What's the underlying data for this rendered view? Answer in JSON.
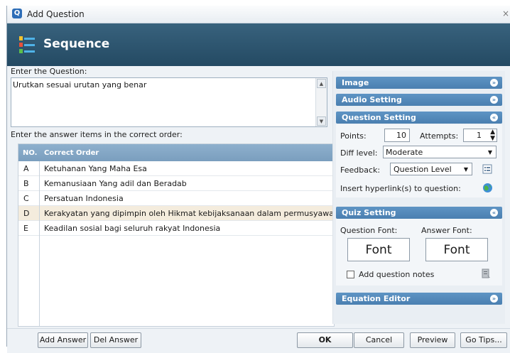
{
  "window": {
    "title": "Add Question",
    "close_glyph": "×"
  },
  "header": {
    "title": "Sequence",
    "icon": "numbered-list-icon"
  },
  "question": {
    "label": "Enter the Question:",
    "value": "Urutkan sesuai urutan yang benar"
  },
  "answers": {
    "label": "Enter the answer items in the correct order:",
    "columns": [
      "NO.",
      "Correct Order"
    ],
    "rows": [
      {
        "no": "A",
        "value": "Ketuhanan Yang Maha Esa"
      },
      {
        "no": "B",
        "value": "Kemanusiaan Yang adil dan Beradab"
      },
      {
        "no": "C",
        "value": "Persatuan Indonesia"
      },
      {
        "no": "D",
        "value": "Kerakyatan yang dipimpin oleh Hikmat kebijaksanaan dalam permusyawar..."
      },
      {
        "no": "E",
        "value": "Keadilan sosial bagi seluruh rakyat Indonesia"
      }
    ]
  },
  "right_panel": {
    "image": {
      "title": "Image"
    },
    "audio": {
      "title": "Audio Setting"
    },
    "question_setting": {
      "title": "Question Setting",
      "points_label": "Points:",
      "points_value": "10",
      "attempts_label": "Attempts:",
      "attempts_value": "1",
      "diff_label": "Diff level:",
      "diff_value": "Moderate",
      "feedback_label": "Feedback:",
      "feedback_value": "Question Level",
      "hyperlink_label": "Insert hyperlink(s) to question:"
    },
    "quiz_setting": {
      "title": "Quiz Setting",
      "question_font_label": "Question Font:",
      "answer_font_label": "Answer Font:",
      "question_font_button": "Font",
      "answer_font_button": "Font",
      "notes_label": "Add question notes"
    },
    "equation": {
      "title": "Equation Editor"
    }
  },
  "footer": {
    "add_answer": "Add Answer",
    "del_answer": "Del Answer",
    "ok": "OK",
    "cancel": "Cancel",
    "preview": "Preview",
    "go_tips": "Go Tips..."
  },
  "colors": {
    "header_bg": "#2f5874",
    "section_header": "#5589ba",
    "table_header": "#86a8c7"
  }
}
